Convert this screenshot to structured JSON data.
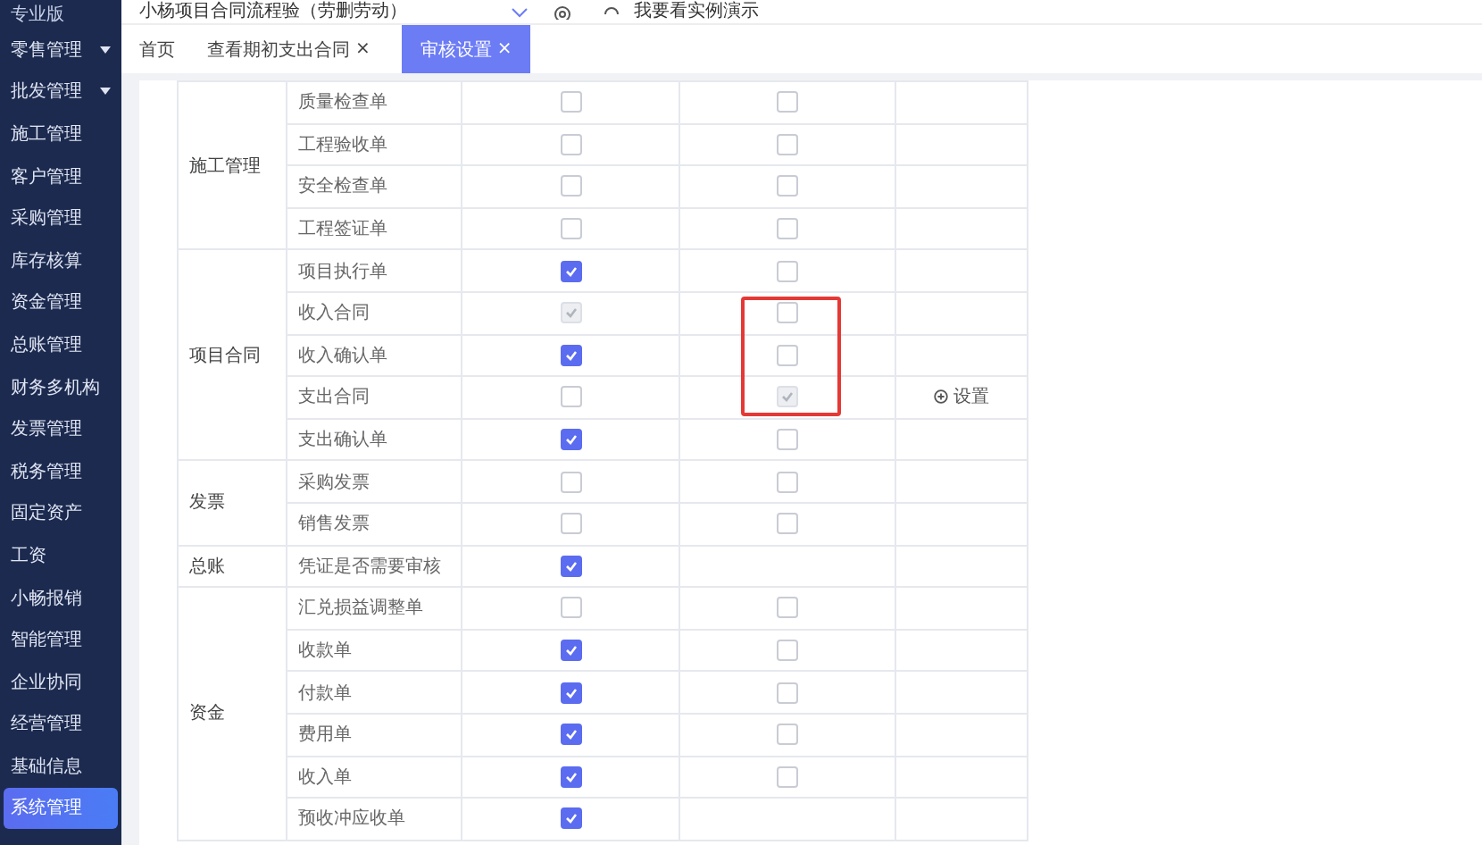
{
  "top_bar": {
    "project": "小杨项目合同流程验（劳删劳动）",
    "demo_link": "我要看实例演示"
  },
  "sidebar": {
    "edition": "专业版",
    "items": [
      {
        "label": "零售管理",
        "has_children": true,
        "selected": false
      },
      {
        "label": "批发管理",
        "has_children": true,
        "selected": false
      },
      {
        "label": "施工管理",
        "has_children": false,
        "selected": false
      },
      {
        "label": "客户管理",
        "has_children": false,
        "selected": false
      },
      {
        "label": "采购管理",
        "has_children": false,
        "selected": false
      },
      {
        "label": "库存核算",
        "has_children": false,
        "selected": false
      },
      {
        "label": "资金管理",
        "has_children": false,
        "selected": false
      },
      {
        "label": "总账管理",
        "has_children": false,
        "selected": false
      },
      {
        "label": "财务多机构",
        "has_children": false,
        "selected": false
      },
      {
        "label": "发票管理",
        "has_children": false,
        "selected": false
      },
      {
        "label": "税务管理",
        "has_children": false,
        "selected": false
      },
      {
        "label": "固定资产",
        "has_children": false,
        "selected": false
      },
      {
        "label": "工资",
        "has_children": false,
        "selected": false
      },
      {
        "label": "小畅报销",
        "has_children": false,
        "selected": false
      },
      {
        "label": "智能管理",
        "has_children": false,
        "selected": false
      },
      {
        "label": "企业协同",
        "has_children": false,
        "selected": false
      },
      {
        "label": "经营管理",
        "has_children": false,
        "selected": false
      },
      {
        "label": "基础信息",
        "has_children": false,
        "selected": false
      },
      {
        "label": "系统管理",
        "has_children": false,
        "selected": true
      }
    ]
  },
  "tabs": [
    {
      "label": "首页",
      "selected": false
    },
    {
      "label": "查看期初支出合同",
      "close": "×",
      "selected": false
    },
    {
      "label": "审核设置",
      "close": "×",
      "selected": true
    }
  ],
  "table": {
    "groups": [
      {
        "name": "施工管理",
        "rows": [
          {
            "item": "质量检查单",
            "audit": {
              "checked": false,
              "disabled": false
            },
            "review": {
              "checked": false,
              "disabled": false
            },
            "highlighted": false
          },
          {
            "item": "工程验收单",
            "audit": {
              "checked": false,
              "disabled": false
            },
            "review": {
              "checked": false,
              "disabled": false
            },
            "highlighted": false
          },
          {
            "item": "安全检查单",
            "audit": {
              "checked": false,
              "disabled": false
            },
            "review": {
              "checked": false,
              "disabled": false
            },
            "highlighted": false
          },
          {
            "item": "工程签证单",
            "audit": {
              "checked": false,
              "disabled": false
            },
            "review": {
              "checked": false,
              "disabled": false
            },
            "highlighted": false
          }
        ]
      },
      {
        "name": "项目合同",
        "rows": [
          {
            "item": "项目执行单",
            "audit": {
              "checked": true,
              "disabled": false
            },
            "review": {
              "checked": false,
              "disabled": false
            },
            "highlighted": false
          },
          {
            "item": "收入合同",
            "audit": {
              "checked": true,
              "disabled": true
            },
            "review": {
              "checked": false,
              "disabled": false
            },
            "highlighted": true
          },
          {
            "item": "收入确认单",
            "audit": {
              "checked": true,
              "disabled": false
            },
            "review": {
              "checked": false,
              "disabled": false
            },
            "highlighted": true
          },
          {
            "item": "支出合同",
            "audit": {
              "checked": false,
              "disabled": false
            },
            "review": {
              "checked": true,
              "disabled": true
            },
            "highlighted": true,
            "action": "设置"
          },
          {
            "item": "支出确认单",
            "audit": {
              "checked": true,
              "disabled": false
            },
            "review": {
              "checked": false,
              "disabled": false
            },
            "highlighted": false
          }
        ]
      },
      {
        "name": "发票",
        "rows": [
          {
            "item": "采购发票",
            "audit": {
              "checked": false,
              "disabled": false
            },
            "review": {
              "checked": false,
              "disabled": false
            },
            "highlighted": false
          },
          {
            "item": "销售发票",
            "audit": {
              "checked": false,
              "disabled": false
            },
            "review": {
              "checked": false,
              "disabled": false
            },
            "highlighted": false
          }
        ]
      },
      {
        "name": "总账",
        "rows": [
          {
            "item": "凭证是否需要审核",
            "audit": {
              "checked": true,
              "disabled": false
            },
            "highlighted": false
          }
        ]
      },
      {
        "name": "资金",
        "rows": [
          {
            "item": "汇兑损益调整单",
            "audit": {
              "checked": false,
              "disabled": false
            },
            "review": {
              "checked": false,
              "disabled": false
            },
            "highlighted": false
          },
          {
            "item": "收款单",
            "audit": {
              "checked": true,
              "disabled": false
            },
            "review": {
              "checked": false,
              "disabled": false
            },
            "highlighted": false
          },
          {
            "item": "付款单",
            "audit": {
              "checked": true,
              "disabled": false
            },
            "review": {
              "checked": false,
              "disabled": false
            },
            "highlighted": false
          },
          {
            "item": "费用单",
            "audit": {
              "checked": true,
              "disabled": false
            },
            "review": {
              "checked": false,
              "disabled": false
            },
            "highlighted": false
          },
          {
            "item": "收入单",
            "audit": {
              "checked": true,
              "disabled": false
            },
            "review": {
              "checked": false,
              "disabled": false
            },
            "highlighted": false
          },
          {
            "item": "预收冲应收单",
            "audit": {
              "checked": true,
              "disabled": false
            },
            "highlighted": false
          }
        ]
      }
    ]
  }
}
